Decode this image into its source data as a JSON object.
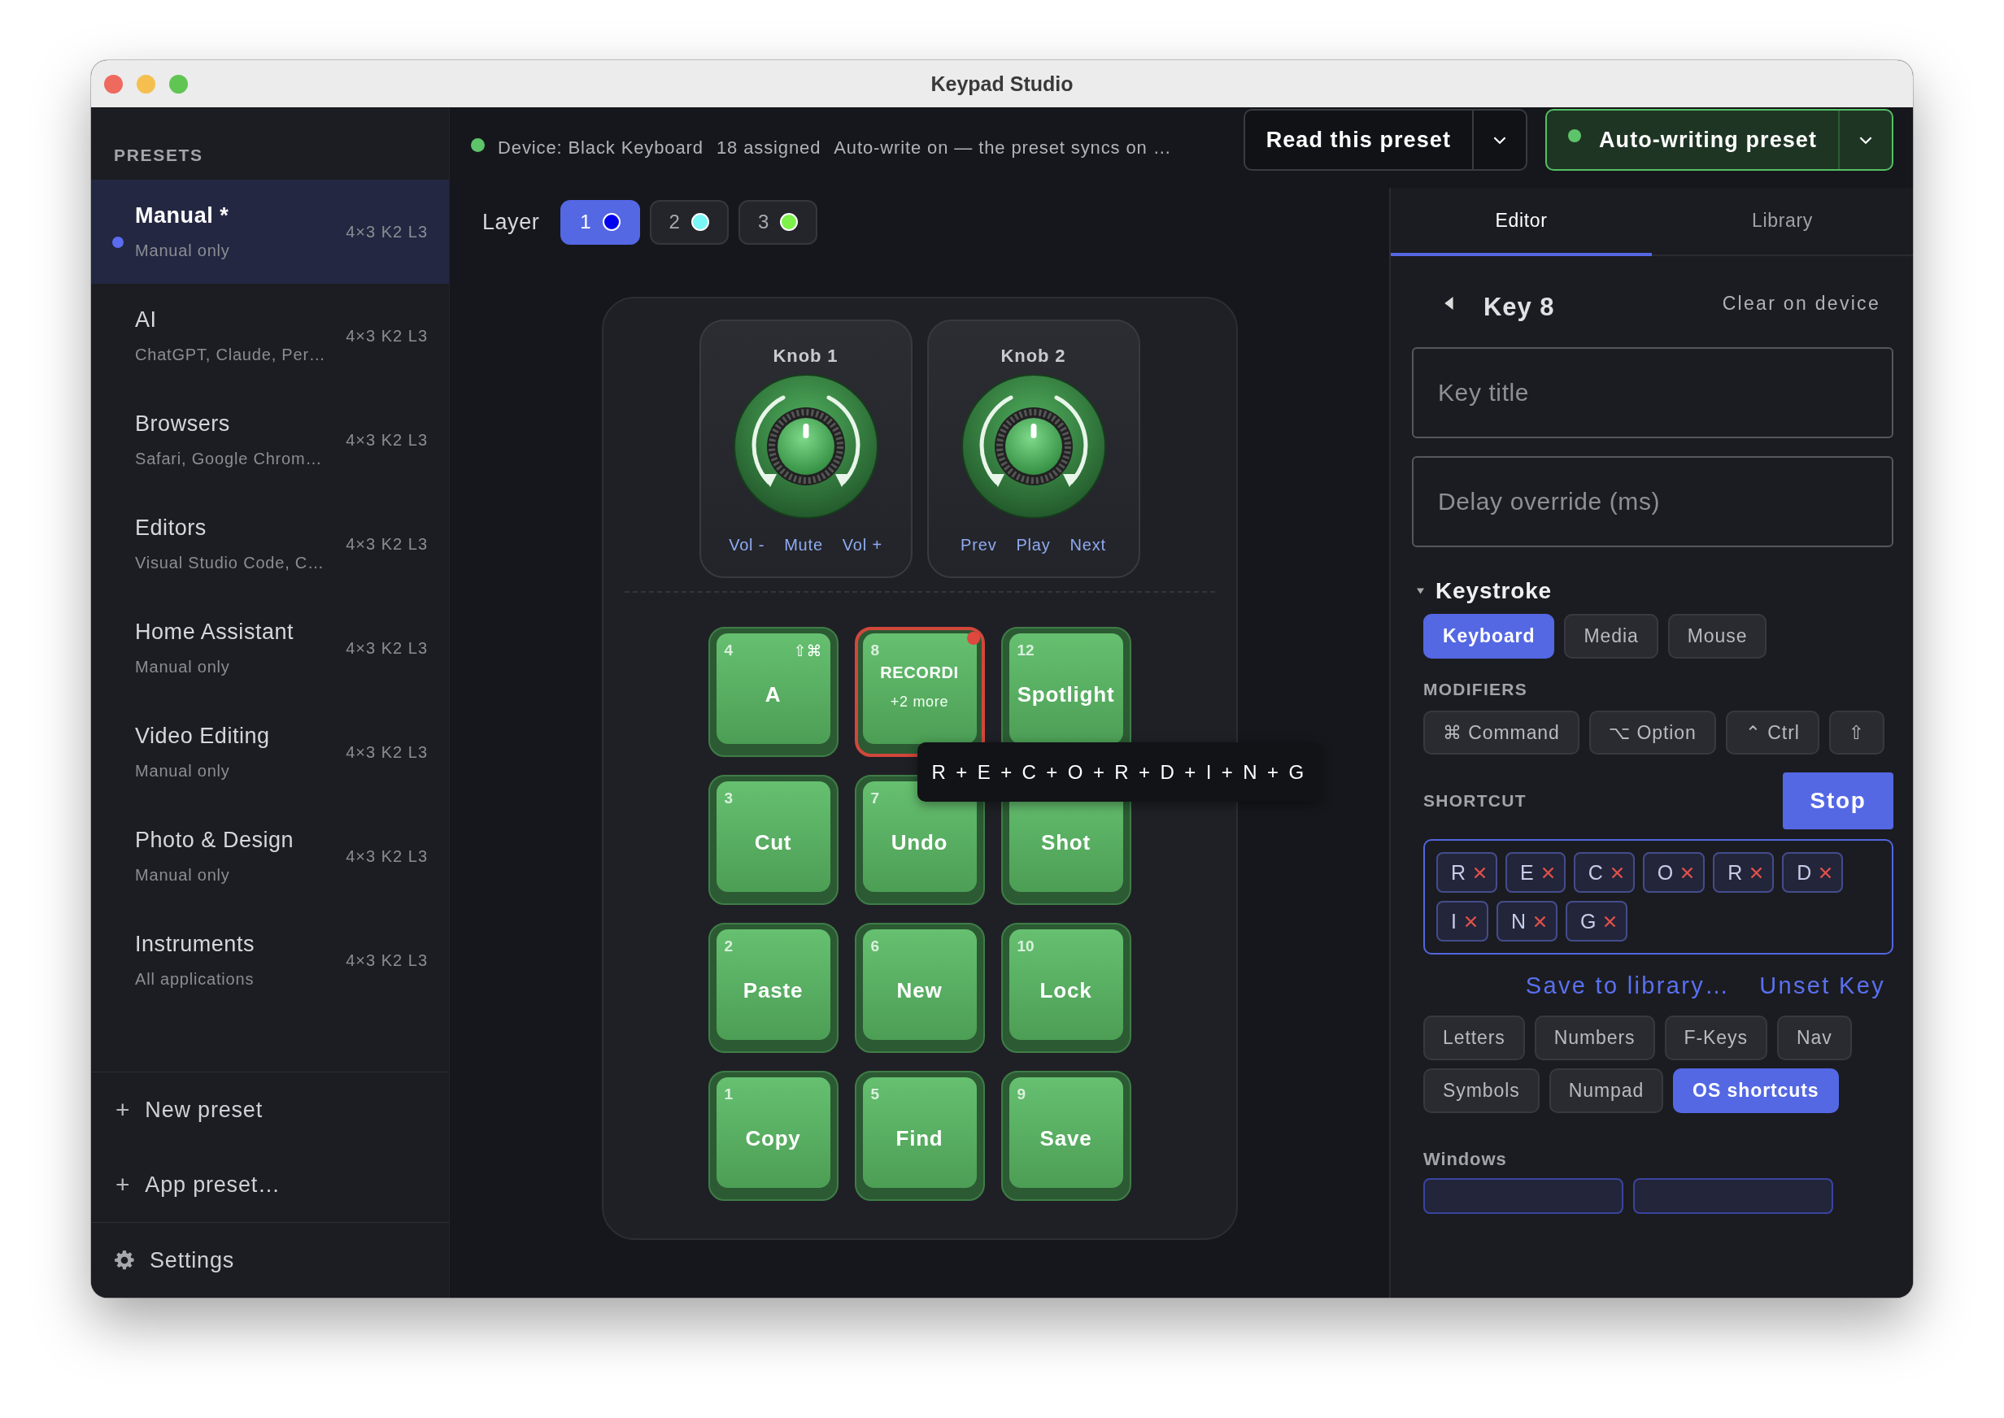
{
  "window": {
    "title": "Keypad Studio"
  },
  "sidebar": {
    "heading": "PRESETS",
    "presets": [
      {
        "name": "Manual *",
        "subtitle": "Manual only",
        "meta": "4×3 K2 L3",
        "selected": true
      },
      {
        "name": "AI",
        "subtitle": "ChatGPT, Claude, Per…",
        "meta": "4×3 K2 L3",
        "selected": false
      },
      {
        "name": "Browsers",
        "subtitle": "Safari, Google Chrom…",
        "meta": "4×3 K2 L3",
        "selected": false
      },
      {
        "name": "Editors",
        "subtitle": "Visual Studio Code, C…",
        "meta": "4×3 K2 L3",
        "selected": false
      },
      {
        "name": "Home Assistant",
        "subtitle": "Manual only",
        "meta": "4×3 K2 L3",
        "selected": false
      },
      {
        "name": "Video Editing",
        "subtitle": "Manual only",
        "meta": "4×3 K2 L3",
        "selected": false
      },
      {
        "name": "Photo & Design",
        "subtitle": "Manual only",
        "meta": "4×3 K2 L3",
        "selected": false
      },
      {
        "name": "Instruments",
        "subtitle": "All applications",
        "meta": "4×3 K2 L3",
        "selected": false
      }
    ],
    "actions": [
      {
        "icon": "+",
        "label": "New preset"
      },
      {
        "icon": "+",
        "label": "App preset…"
      }
    ],
    "settings": {
      "label": "Settings"
    }
  },
  "status": {
    "connected": true,
    "device": "Device: Black Keyboard",
    "assigned": "18 assigned",
    "sync": "Auto-write on — the preset syncs on …"
  },
  "read_button": {
    "label": "Read this preset"
  },
  "auto_write_button": {
    "label": "Auto-writing preset",
    "active": true
  },
  "layers": {
    "label": "Layer",
    "items": [
      {
        "label": "1",
        "color": "#0000ee",
        "selected": true
      },
      {
        "label": "2",
        "color": "#7af7f7",
        "selected": false
      },
      {
        "label": "3",
        "color": "#7cf24a",
        "selected": false
      }
    ]
  },
  "knobs": [
    {
      "title": "Knob 1",
      "actions": [
        "Vol -",
        "Mute",
        "Vol +"
      ]
    },
    {
      "title": "Knob 2",
      "actions": [
        "Prev",
        "Play",
        "Next"
      ]
    }
  ],
  "keys": [
    {
      "number": "4",
      "label": "A",
      "modifiers": "⇧⌘",
      "selected": false,
      "recording": false
    },
    {
      "number": "8",
      "label": "RECORDI",
      "more": "+2 more",
      "selected": true,
      "recording": true
    },
    {
      "number": "12",
      "label": "Spotlight",
      "selected": false,
      "recording": false
    },
    {
      "number": "3",
      "label": "Cut",
      "selected": false,
      "recording": false
    },
    {
      "number": "7",
      "label": "Undo",
      "selected": false,
      "recording": false
    },
    {
      "label": "Shot",
      "selected": false,
      "recording": false
    },
    {
      "number": "2",
      "label": "Paste",
      "selected": false,
      "recording": false
    },
    {
      "number": "6",
      "label": "New",
      "selected": false,
      "recording": false
    },
    {
      "number": "10",
      "label": "Lock",
      "selected": false,
      "recording": false
    },
    {
      "number": "1",
      "label": "Copy",
      "selected": false,
      "recording": false
    },
    {
      "number": "5",
      "label": "Find",
      "selected": false,
      "recording": false
    },
    {
      "number": "9",
      "label": "Save",
      "selected": false,
      "recording": false
    }
  ],
  "tooltip": {
    "text": "R + E + C + O + R + D + I + N + G"
  },
  "tabs": [
    {
      "label": "Editor",
      "selected": true
    },
    {
      "label": "Library",
      "selected": false
    }
  ],
  "editor": {
    "title": "Key 8",
    "clear_button": "Clear on device",
    "title_field": {
      "placeholder": "Key title"
    },
    "delay_field": {
      "placeholder": "Delay override (ms)"
    },
    "section": {
      "title": "Keystroke",
      "expanded": true
    },
    "types": [
      {
        "label": "Keyboard",
        "selected": true
      },
      {
        "label": "Media",
        "selected": false
      },
      {
        "label": "Mouse",
        "selected": false
      }
    ],
    "modifiers_label": "MODIFIERS",
    "modifiers": [
      {
        "label": "⌘ Command",
        "selected": false
      },
      {
        "label": "⌥ Option",
        "selected": false
      },
      {
        "label": "⌃ Ctrl",
        "selected": false
      },
      {
        "label": "⇧",
        "selected": false
      }
    ],
    "shortcut_label": "SHORTCUT",
    "stop_button": "Stop",
    "shortcut_keys": [
      "R",
      "E",
      "C",
      "O",
      "R",
      "D",
      "I",
      "N",
      "G"
    ],
    "links": [
      "Save to library…",
      "Unset Key"
    ],
    "categories": [
      {
        "label": "Letters",
        "selected": false
      },
      {
        "label": "Numbers",
        "selected": false
      },
      {
        "label": "F-Keys",
        "selected": false
      },
      {
        "label": "Nav",
        "selected": false
      },
      {
        "label": "Symbols",
        "selected": false
      },
      {
        "label": "Numpad",
        "selected": false
      },
      {
        "label": "OS shortcuts",
        "selected": true
      }
    ],
    "group_title": "Windows"
  }
}
